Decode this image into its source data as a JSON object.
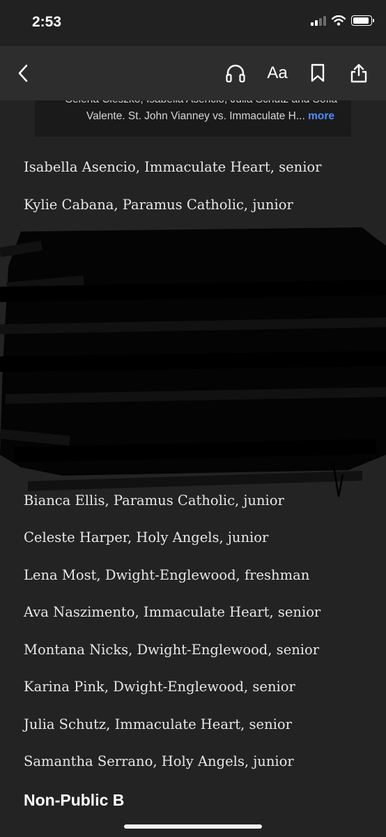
{
  "status_bar": {
    "time": "2:53",
    "signal_icon": "cellular-signal-icon",
    "wifi_icon": "wifi-icon",
    "battery_icon": "battery-icon"
  },
  "toolbar": {
    "back_icon": "chevron-left-icon",
    "listen_icon": "headphones-icon",
    "text_size_label": "Aa",
    "bookmark_icon": "bookmark-icon",
    "share_icon": "share-icon"
  },
  "caption": {
    "line1": "Selena Cieszko, Isabella Asencio, Julia Schutz and Sofia",
    "line2": "Valente. St. John Vianney vs. Immaculate H...",
    "more_label": "more"
  },
  "entries_top": [
    "Isabella Asencio, Immaculate Heart, senior",
    "Kylie Cabana, Paramus Catholic, junior"
  ],
  "entries_bottom": [
    "Bianca Ellis, Paramus Catholic, junior",
    "Celeste Harper, Holy Angels, junior",
    "Lena Most, Dwight-Englewood, freshman",
    "Ava Naszimento, Immaculate Heart, senior",
    "Montana Nicks, Dwight-Englewood, senior",
    "Karina Pink, Dwight-Englewood, senior",
    "Julia Schutz, Immaculate Heart, senior",
    "Samantha Serrano, Holy Angels, junior"
  ],
  "section_heading": "Non-Public B",
  "colors": {
    "background": "#232323",
    "toolbar": "#2d2d2d",
    "caption_bg": "#1a1a1a",
    "link": "#4d8dff"
  }
}
